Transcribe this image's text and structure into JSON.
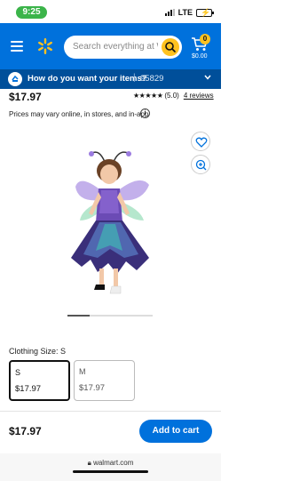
{
  "status": {
    "time": "9:25",
    "network": "LTE"
  },
  "header": {
    "search_placeholder": "Search everything at W",
    "cart_count": "0",
    "cart_total": "$0.00",
    "brand_color": "#0071dc",
    "accent_color": "#ffc220"
  },
  "delivery": {
    "title": "How do you want your items?",
    "separator": "|",
    "zip": "95829"
  },
  "product": {
    "price": "$17.97",
    "stars": "★★★★★",
    "rating_text": "(5.0)",
    "reviews_link": "4 reviews",
    "price_note": "Prices may vary online, in stores, and in-app",
    "image_index_fraction": 0.26
  },
  "size": {
    "label": "Clothing Size: S",
    "options": [
      {
        "name": "S",
        "price": "$17.97",
        "selected": true
      },
      {
        "name": "M",
        "price": "$17.97",
        "selected": false
      }
    ]
  },
  "footer": {
    "price": "$17.97",
    "add_to_cart": "Add to cart",
    "url": "walmart.com"
  }
}
